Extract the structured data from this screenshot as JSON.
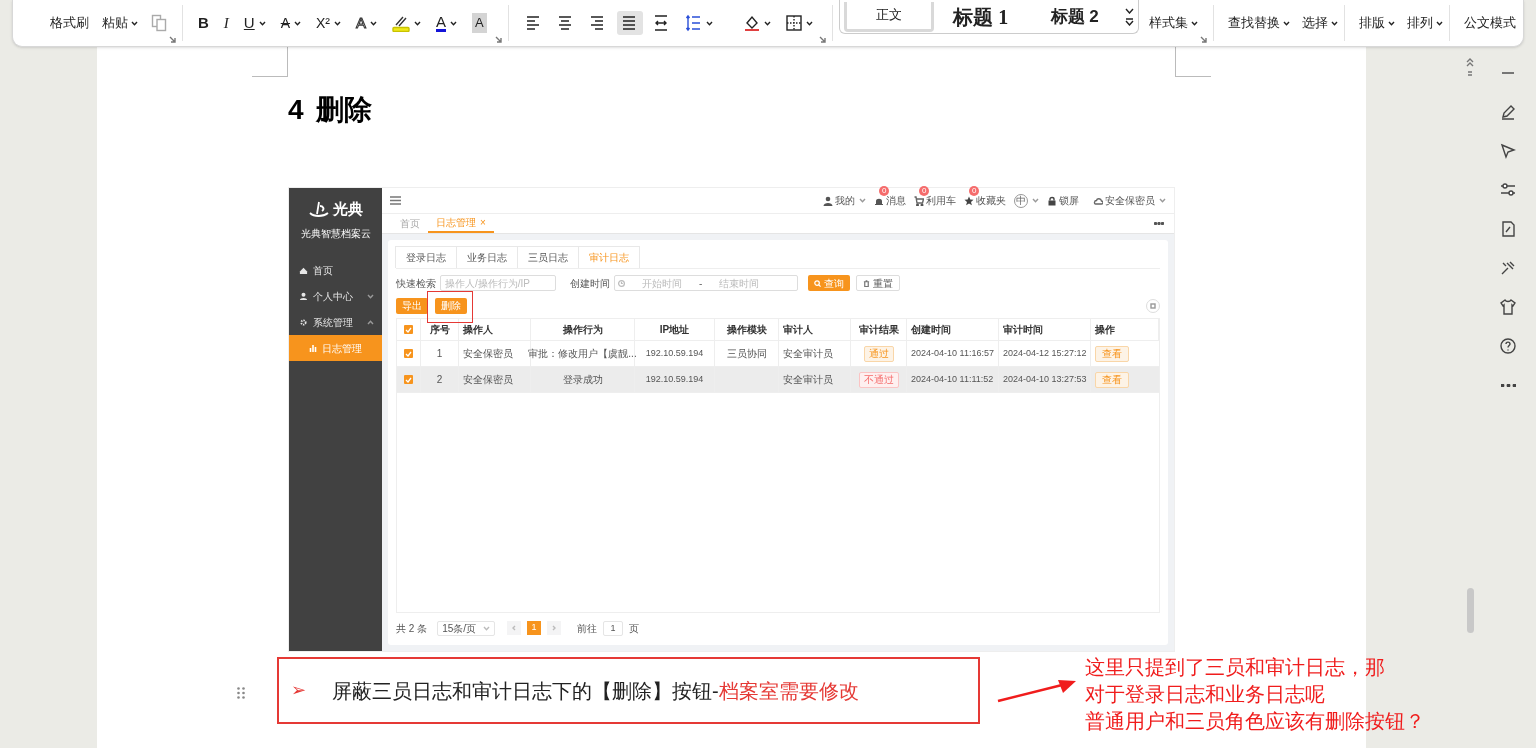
{
  "ribbon": {
    "clipboard": [
      {
        "label": "格式刷",
        "dropdown": false
      },
      {
        "label": "粘贴",
        "dropdown": true
      }
    ],
    "font_buttons": [
      {
        "kind": "bold",
        "label": "B",
        "dropdown": false
      },
      {
        "kind": "italic",
        "label": "I",
        "dropdown": false
      },
      {
        "kind": "underline",
        "label": "U",
        "dropdown": true
      },
      {
        "kind": "strike",
        "label": "A",
        "dropdown": true
      },
      {
        "kind": "superscript",
        "label": "X²",
        "dropdown": true
      },
      {
        "kind": "outline",
        "label": "A",
        "dropdown": true
      },
      {
        "kind": "highlight",
        "dropdown": true
      },
      {
        "kind": "color",
        "label": "A",
        "dropdown": true
      },
      {
        "kind": "shade",
        "label": "A",
        "dropdown": false
      }
    ],
    "paragraph_buttons": [
      {
        "kind": "align_left",
        "selected": false,
        "dropdown": false
      },
      {
        "kind": "align_center",
        "selected": false,
        "dropdown": false
      },
      {
        "kind": "align_right",
        "selected": false,
        "dropdown": false
      },
      {
        "kind": "justify",
        "selected": true,
        "dropdown": false
      },
      {
        "kind": "distribute",
        "selected": false,
        "dropdown": false
      },
      {
        "kind": "line_spacing",
        "selected": false,
        "dropdown": true
      },
      {
        "kind": "fill",
        "selected": false,
        "dropdown": true
      },
      {
        "kind": "border",
        "selected": false,
        "dropdown": true
      }
    ],
    "styles": [
      {
        "label": "正文",
        "selected": true
      },
      {
        "label": "标题 1",
        "selected": false
      },
      {
        "label": "标题 2",
        "selected": false
      }
    ],
    "tool_groups": [
      {
        "items": [
          {
            "label": "样式集",
            "dropdown": true
          }
        ]
      },
      {
        "items": [
          {
            "label": "查找替换",
            "dropdown": true
          },
          {
            "label": "选择",
            "dropdown": true
          }
        ]
      },
      {
        "items": [
          {
            "label": "排版",
            "dropdown": true
          },
          {
            "label": "排列",
            "dropdown": true
          }
        ]
      },
      {
        "items": [
          {
            "label": "公文模式",
            "dropdown": false
          }
        ]
      }
    ]
  },
  "document": {
    "heading": {
      "number": "4",
      "text": "删除"
    },
    "app": {
      "brand": {
        "logo": "光典",
        "name": "光典智慧档案云"
      },
      "menu": [
        {
          "kind": "link",
          "label": "首页",
          "selected": false
        },
        {
          "kind": "group",
          "label": "个人中心",
          "selected": false,
          "expanded": false
        },
        {
          "kind": "group",
          "label": "系统管理",
          "selected": false,
          "expanded": true,
          "children": [
            {
              "label": "日志管理",
              "selected": true
            }
          ]
        }
      ],
      "header": [
        {
          "kind": "user",
          "label": "我的",
          "dropdown": true
        },
        {
          "kind": "bell",
          "label": "消息",
          "badge": "0",
          "dropdown": false
        },
        {
          "kind": "cart",
          "label": "利用车",
          "badge": "0",
          "dropdown": false
        },
        {
          "kind": "star",
          "label": "收藏夹",
          "badge": "0",
          "dropdown": false
        },
        {
          "kind": "lang",
          "label": "中",
          "dropdown": true
        },
        {
          "kind": "lock",
          "label": "锁屏",
          "dropdown": false
        },
        {
          "kind": "account",
          "label": "安全保密员",
          "dropdown": true
        }
      ],
      "page_tabs": [
        {
          "label": "首页",
          "selected": false
        },
        {
          "label": "日志管理",
          "selected": true,
          "close": "×"
        }
      ],
      "log_tabs": [
        {
          "label": "登录日志",
          "selected": false
        },
        {
          "label": "业务日志",
          "selected": false
        },
        {
          "label": "三员日志",
          "selected": false
        },
        {
          "label": "审计日志",
          "selected": true
        }
      ],
      "filters": {
        "quick_label": "快速检索",
        "quick_placeholder": "操作人/操作行为/IP",
        "time_label": "创建时间",
        "start_placeholder": "开始时间",
        "separator": "-",
        "end_placeholder": "结束时间",
        "search_button": "查询",
        "reset_button": "重置"
      },
      "actions": [
        {
          "label": "导出",
          "highlighted": false
        },
        {
          "label": "删除",
          "highlighted": true
        }
      ],
      "table": {
        "all_checked": true,
        "columns": [
          "序号",
          "操作人",
          "操作行为",
          "IP地址",
          "操作模块",
          "审计人",
          "审计结果",
          "创建时间",
          "审计时间",
          "操作"
        ],
        "rows": [
          {
            "checked": true,
            "hovered": false,
            "index": "1",
            "operator": "安全保密员",
            "behavior": "审批：修改用户【虞靓...",
            "ip": "192.10.59.194",
            "module": "三员协同",
            "auditor": "安全审计员",
            "result": {
              "label": "通过",
              "kind": "pass"
            },
            "created": "2024-04-10 11:16:57",
            "audited": "2024-04-12 15:27:12",
            "action": "查看"
          },
          {
            "checked": true,
            "hovered": true,
            "index": "2",
            "operator": "安全保密员",
            "behavior": "登录成功",
            "ip": "192.10.59.194",
            "auditor": "安全审计员",
            "result": {
              "label": "不通过",
              "kind": "fail"
            },
            "created": "2024-04-10 11:11:52",
            "audited": "2024-04-10 13:27:53",
            "action": "查看"
          }
        ]
      },
      "pagination": {
        "total": "共 2 条",
        "page_size": "15条/页",
        "pages": [
          {
            "label": "1",
            "selected": true
          }
        ],
        "goto_label": "前往",
        "goto_value": "1",
        "goto_suffix": "页"
      }
    },
    "bullet": {
      "marker": "➢",
      "text": "屏蔽三员日志和审计日志下的【删除】按钮-",
      "note": "档案室需要修改"
    }
  },
  "annotation": {
    "lines": [
      "这里只提到了三员和审计日志，那",
      "对于登录日志和业务日志呢",
      "普通用户和三员角色应该有删除按钮？"
    ]
  }
}
